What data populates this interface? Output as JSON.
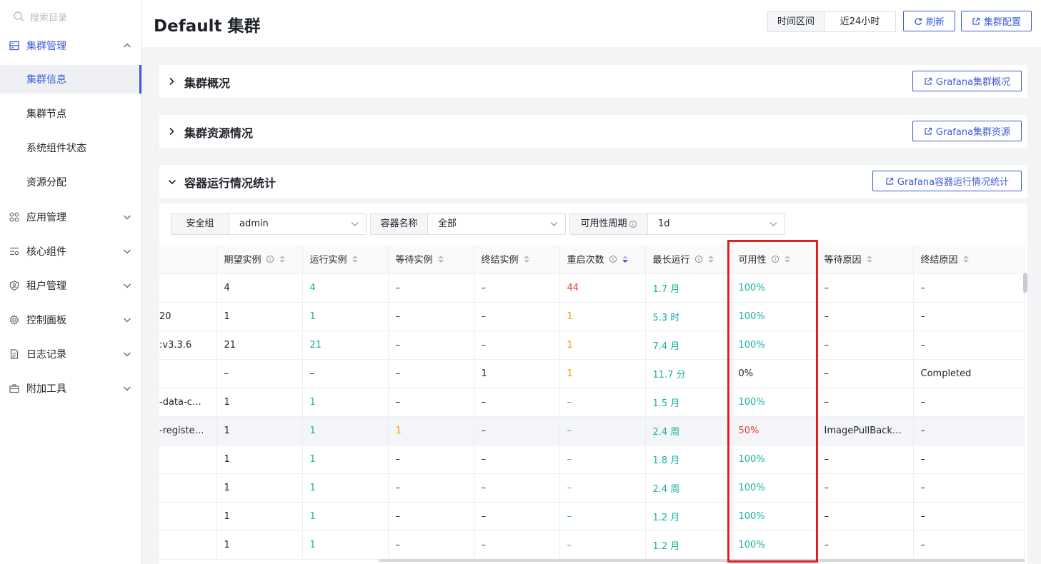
{
  "sidebar": {
    "search_placeholder": "搜索目录",
    "groups": [
      {
        "label": "集群管理",
        "icon": "server-icon",
        "expanded": true
      },
      {
        "label": "应用管理",
        "icon": "apps-grid-icon"
      },
      {
        "label": "核心组件",
        "icon": "list-settings-icon"
      },
      {
        "label": "租户管理",
        "icon": "shield-user-icon"
      },
      {
        "label": "控制面板",
        "icon": "gear-icon"
      },
      {
        "label": "日志记录",
        "icon": "document-icon"
      },
      {
        "label": "附加工具",
        "icon": "toolbox-icon"
      }
    ],
    "sub_items": [
      "集群信息",
      "集群节点",
      "系统组件状态",
      "资源分配"
    ],
    "active_sub": "集群信息"
  },
  "header": {
    "title": "Default 集群",
    "time_label": "时间区间",
    "time_value": "近24小时",
    "refresh_label": "刷新",
    "config_label": "集群配置"
  },
  "sections": [
    {
      "title": "集群概况",
      "button": "Grafana集群概况",
      "expanded": false
    },
    {
      "title": "集群资源情况",
      "button": "Grafana集群资源",
      "expanded": false
    },
    {
      "title": "容器运行情况统计",
      "button": "Grafana容器运行情况统计",
      "expanded": true
    }
  ],
  "filters": [
    {
      "label": "安全组",
      "value": "admin"
    },
    {
      "label": "容器名称",
      "value": "全部"
    },
    {
      "label": "可用性周期",
      "value": "1d",
      "info": true
    }
  ],
  "table": {
    "columns": [
      "",
      "期望实例",
      "运行实例",
      "等待实例",
      "终结实例",
      "重启次数",
      "最长运行",
      "可用性",
      "等待原因",
      "终结原因"
    ],
    "rows": [
      [
        "",
        "4",
        "4",
        "–",
        "–",
        "44",
        "1.7 月",
        "100%",
        "–",
        "–"
      ],
      [
        "20",
        "1",
        "1",
        "–",
        "–",
        "1",
        "5.3 时",
        "100%",
        "–",
        "–"
      ],
      [
        ":v3.3.6",
        "21",
        "21",
        "–",
        "–",
        "1",
        "7.4 月",
        "100%",
        "–",
        "–"
      ],
      [
        "",
        "–",
        "–",
        "–",
        "1",
        "1",
        "11.7 分",
        "0%",
        "–",
        "Completed"
      ],
      [
        "-data-c…",
        "1",
        "1",
        "–",
        "–",
        "–",
        "1.5 月",
        "100%",
        "–",
        "–"
      ],
      [
        "-registe…",
        "1",
        "1",
        "1",
        "–",
        "–",
        "2.4 周",
        "50%",
        "ImagePullBack…",
        "–"
      ],
      [
        "",
        "1",
        "1",
        "–",
        "–",
        "–",
        "1.8 月",
        "100%",
        "–",
        "–"
      ],
      [
        "",
        "1",
        "1",
        "–",
        "–",
        "–",
        "2.4 周",
        "100%",
        "–",
        "–"
      ],
      [
        "",
        "1",
        "1",
        "–",
        "–",
        "–",
        "1.2 月",
        "100%",
        "–",
        "–"
      ],
      [
        "",
        "1",
        "1",
        "–",
        "–",
        "–",
        "1.2 月",
        "100%",
        "–",
        "–"
      ]
    ]
  },
  "colors": {
    "primary": "#3b5bdb",
    "green": "#16b2a0",
    "red": "#f03e3e",
    "orange": "#f59f00",
    "highlight": "#e02020"
  }
}
